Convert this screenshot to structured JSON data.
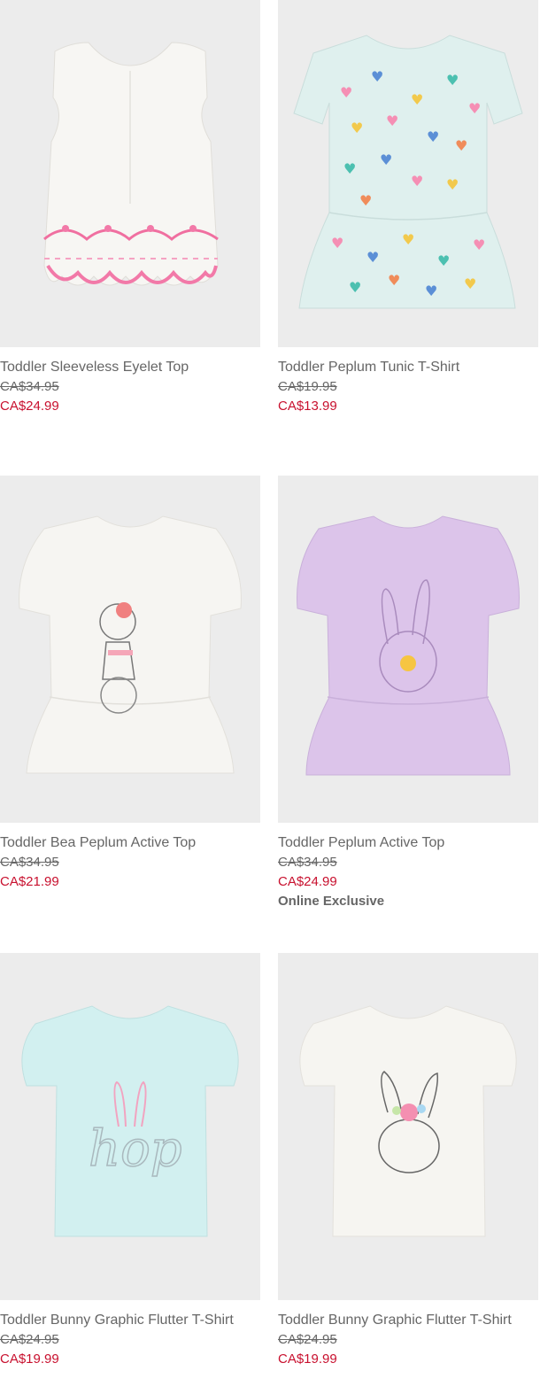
{
  "products": [
    {
      "name": "Toddler Sleeveless Eyelet Top",
      "original_price": "CA$34.95",
      "sale_price": "CA$24.99"
    },
    {
      "name": "Toddler Peplum Tunic T-Shirt",
      "original_price": "CA$19.95",
      "sale_price": "CA$13.99"
    },
    {
      "name": "Toddler Bea Peplum Active Top",
      "original_price": "CA$34.95",
      "sale_price": "CA$21.99"
    },
    {
      "name": "Toddler Peplum Active Top",
      "original_price": "CA$34.95",
      "sale_price": "CA$24.99",
      "badge": "Online Exclusive"
    },
    {
      "name": "Toddler Bunny Graphic Flutter T-Shirt",
      "original_price": "CA$24.95",
      "sale_price": "CA$19.99"
    },
    {
      "name": "Toddler Bunny Graphic Flutter T-Shirt",
      "original_price": "CA$24.95",
      "sale_price": "CA$19.99"
    }
  ],
  "colors": {
    "image_background": "#ececec",
    "name_text": "#666666",
    "sale_price": "#c8102e"
  }
}
